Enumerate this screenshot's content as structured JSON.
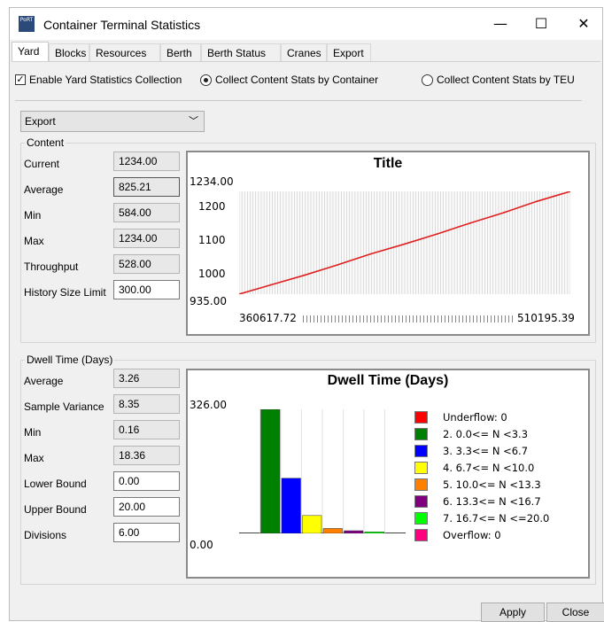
{
  "window": {
    "title": "Container Terminal Statistics",
    "icon_text": "PoRT",
    "minimize_glyph": "—",
    "maximize_glyph": "☐",
    "close_glyph": "✕"
  },
  "tabs": [
    {
      "label": "Yard",
      "active": true
    },
    {
      "label": "Blocks"
    },
    {
      "label": "Resources"
    },
    {
      "label": "Berth"
    },
    {
      "label": "Berth Status"
    },
    {
      "label": "Cranes"
    },
    {
      "label": "Export"
    }
  ],
  "options": {
    "enable_label": "Enable Yard Statistics Collection",
    "enable_checked": true,
    "by_container_label": "Collect Content Stats by Container",
    "by_container_selected": true,
    "by_teu_label": "Collect Content Stats by TEU",
    "by_teu_selected": false
  },
  "dropdown": {
    "value": "Export"
  },
  "content": {
    "group_title": "Content",
    "fields": [
      {
        "label": "Current",
        "value": "1234.00",
        "readonly": true
      },
      {
        "label": "Average",
        "value": "825.21",
        "readonly": true
      },
      {
        "label": "Min",
        "value": "584.00",
        "readonly": true
      },
      {
        "label": "Max",
        "value": "1234.00",
        "readonly": true
      },
      {
        "label": "Throughput",
        "value": "528.00",
        "readonly": true
      },
      {
        "label": "History Size Limit",
        "value": "300.00",
        "readonly": false
      }
    ]
  },
  "dwell": {
    "group_title": "Dwell Time (Days)",
    "fields": [
      {
        "label": "Average",
        "value": "3.26",
        "readonly": true
      },
      {
        "label": "Sample Variance",
        "value": "8.35",
        "readonly": true
      },
      {
        "label": "Min",
        "value": "0.16",
        "readonly": true
      },
      {
        "label": "Max",
        "value": "18.36",
        "readonly": true
      },
      {
        "label": "Lower Bound",
        "value": "0.00",
        "readonly": false
      },
      {
        "label": "Upper Bound",
        "value": "20.00",
        "readonly": false
      },
      {
        "label": "Divisions",
        "value": "6.00",
        "readonly": false
      }
    ]
  },
  "line_chart": {
    "title": "Title",
    "y_max_label": "1234.00",
    "y_min_label": "935.00",
    "y_ticks": [
      "1200",
      "1100",
      "1000"
    ],
    "x_start_label": "360617.72",
    "x_end_label": "510195.39"
  },
  "bar_chart": {
    "title": "Dwell Time (Days)",
    "y_max_label": "326.00",
    "y_min_label": "0.00"
  },
  "chart_data": [
    {
      "type": "line",
      "title": "Title",
      "ylim": [
        935,
        1234
      ],
      "xlim": [
        360617.72,
        510195.39
      ],
      "series": [
        {
          "color": "#e02020",
          "x": [
            360617.72,
            375000,
            390000,
            405000,
            420000,
            435000,
            450000,
            465000,
            480000,
            495000,
            510195.39
          ],
          "y": [
            935,
            962,
            990,
            1020,
            1052,
            1080,
            1110,
            1142,
            1172,
            1205,
            1234
          ]
        }
      ]
    },
    {
      "type": "bar",
      "title": "Dwell Time (Days)",
      "ylim": [
        0,
        326
      ],
      "categories": [
        "Underflow: 0",
        "2. 0.0<= N <3.3",
        "3. 3.3<= N <6.7",
        "4. 6.7<= N <10.0",
        "5. 10.0<= N <13.3",
        "6. 13.3<= N <16.7",
        "7. 16.7<= N <=20.0",
        "Overflow: 0"
      ],
      "values": [
        0,
        326,
        145,
        47,
        13,
        7,
        4,
        0
      ],
      "colors": [
        "#ff0000",
        "#008000",
        "#0000ff",
        "#ffff00",
        "#ff8000",
        "#800080",
        "#00ff00",
        "#ff0080"
      ]
    }
  ],
  "buttons": {
    "apply": "Apply",
    "close": "Close"
  }
}
